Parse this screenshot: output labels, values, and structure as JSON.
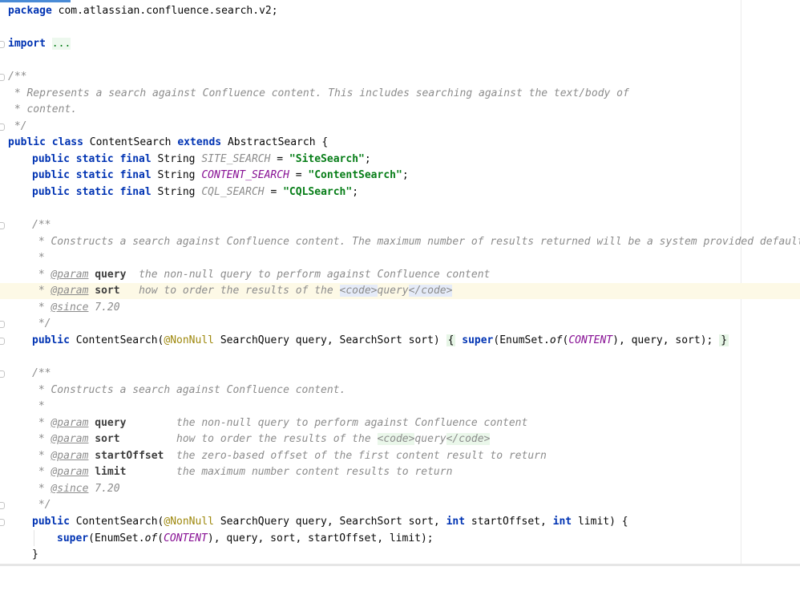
{
  "editor": {
    "lines": {
      "l1": {
        "kw": "package",
        "rest": " com.atlassian.confluence.search.v2;"
      },
      "l3": {
        "kw": "import",
        "fold": "..."
      },
      "l5": {
        "text": "/**"
      },
      "l6": {
        "text": " * Represents a search against Confluence content. This includes searching against the text/body of"
      },
      "l7": {
        "text": " * content."
      },
      "l8": {
        "text": " */"
      },
      "l9": {
        "kw1": "public",
        "kw2": "class",
        "name": "ContentSearch",
        "kw3": "extends",
        "rest": "AbstractSearch {"
      },
      "l10": {
        "kw": "public static final",
        "type": "String",
        "const": "SITE_SEARCH",
        "eq": " = ",
        "str": "\"SiteSearch\"",
        "end": ";"
      },
      "l11": {
        "kw": "public static final",
        "type": "String",
        "const": "CONTENT_SEARCH",
        "eq": " = ",
        "str": "\"ContentSearch\"",
        "end": ";"
      },
      "l12": {
        "kw": "public static final",
        "type": "String",
        "const": "CQL_SEARCH",
        "eq": " = ",
        "str": "\"CQLSearch\"",
        "end": ";"
      },
      "l14": {
        "text": "/**"
      },
      "l15": {
        "text": " * Constructs a search against Confluence content. The maximum number of results returned will be a system provided default."
      },
      "l16": {
        "text": " *"
      },
      "l17": {
        "star": " * ",
        "tag": "@param",
        "param": "query",
        "desc": "  the non-null query to perform against Confluence content"
      },
      "l18": {
        "star": " * ",
        "tag": "@param",
        "param": "sort",
        "desc": "   how to order the results of the ",
        "open": "<code>",
        "mid": "query",
        "close": "</code>"
      },
      "l19": {
        "star": " * ",
        "tag": "@since",
        "desc": " 7.20"
      },
      "l20": {
        "text": " */"
      },
      "l21": {
        "kw": "public",
        "name": " ContentSearch(",
        "anno": "@NonNull",
        "params": " SearchQuery query, SearchSort sort) ",
        "ob": "{",
        "kw2": "super",
        "call1": "(EnumSet.",
        "of": "of",
        "paren": "(",
        "const": "CONTENT",
        "call2": "), query, sort); ",
        "cb": "}"
      },
      "l23": {
        "text": "/**"
      },
      "l24": {
        "text": " * Constructs a search against Confluence content."
      },
      "l25": {
        "text": " *"
      },
      "l26": {
        "star": " * ",
        "tag": "@param",
        "param": "query",
        "desc": "        the non-null query to perform against Confluence content"
      },
      "l27": {
        "star": " * ",
        "tag": "@param",
        "param": "sort",
        "desc": "         how to order the results of the ",
        "open": "<code>",
        "mid": "query",
        "close": "</code>"
      },
      "l28": {
        "star": " * ",
        "tag": "@param",
        "param": "startOffset",
        "desc": "  the zero-based offset of the first content result to return"
      },
      "l29": {
        "star": " * ",
        "tag": "@param",
        "param": "limit",
        "desc": "        the maximum number content results to return"
      },
      "l30": {
        "star": " * ",
        "tag": "@since",
        "desc": " 7.20"
      },
      "l31": {
        "text": " */"
      },
      "l32": {
        "kw": "public",
        "name": " ContentSearch(",
        "anno": "@NonNull",
        "params1": " SearchQuery query, SearchSort sort, ",
        "int1": "int",
        "p2": " startOffset, ",
        "int2": "int",
        "p3": " limit) {"
      },
      "l33": {
        "kw": "super",
        "call1": "(EnumSet.",
        "of": "of",
        "paren": "(",
        "const": "CONTENT",
        "call2": "), query, sort, startOffset, limit);"
      },
      "l34": {
        "text": "}"
      }
    }
  },
  "colors": {
    "keyword": "#0033b3",
    "string": "#067d17",
    "comment": "#8c8c8c",
    "constant": "#871094",
    "annotation": "#9e880d",
    "highlight_line": "#fdf9e6"
  }
}
